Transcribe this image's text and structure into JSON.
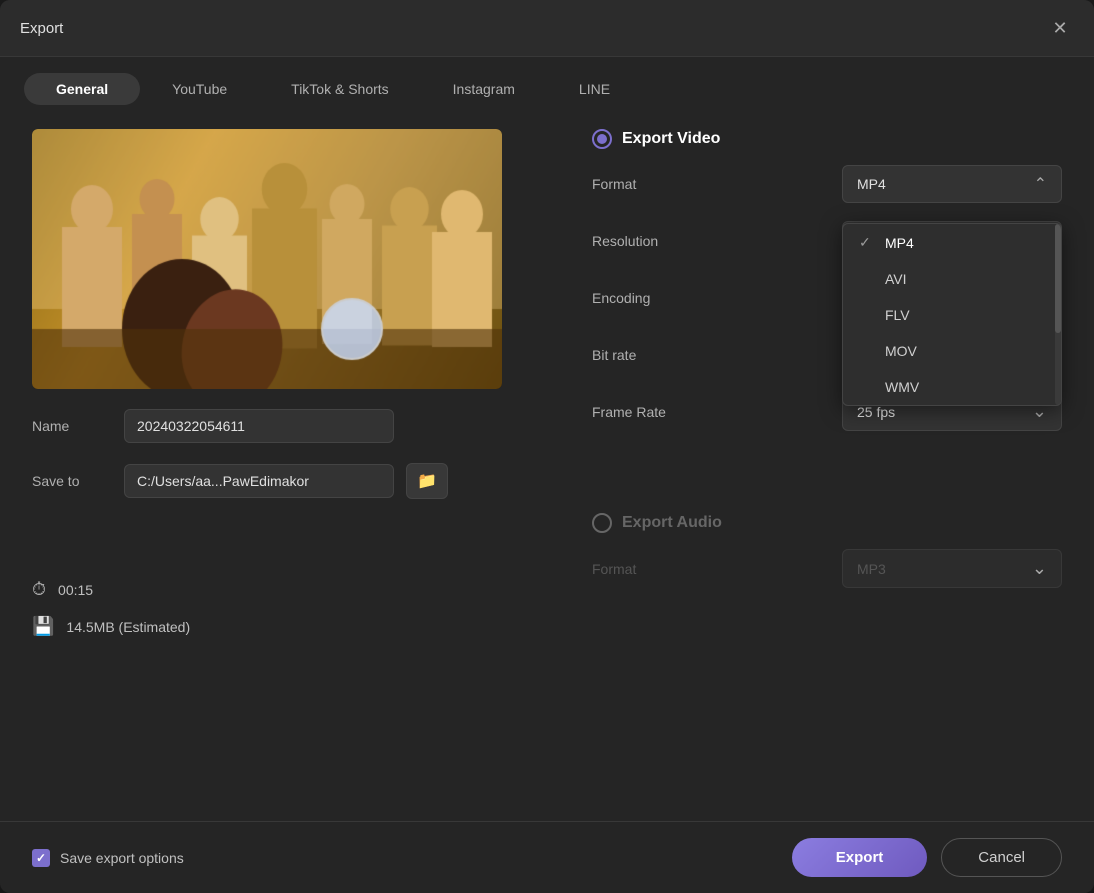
{
  "dialog": {
    "title": "Export",
    "close_label": "✕"
  },
  "tabs": [
    {
      "id": "general",
      "label": "General",
      "active": true
    },
    {
      "id": "youtube",
      "label": "YouTube",
      "active": false
    },
    {
      "id": "tiktok",
      "label": "TikTok & Shorts",
      "active": false
    },
    {
      "id": "instagram",
      "label": "Instagram",
      "active": false
    },
    {
      "id": "line",
      "label": "LINE",
      "active": false
    }
  ],
  "export_video": {
    "section_title": "Export Video",
    "format_label": "Format",
    "format_value": "MP4",
    "resolution_label": "Resolution",
    "encoding_label": "Encoding",
    "bitrate_label": "Bit rate",
    "framerate_label": "Frame Rate",
    "framerate_value": "25  fps",
    "dropdown_options": [
      {
        "label": "MP4",
        "selected": true
      },
      {
        "label": "AVI",
        "selected": false
      },
      {
        "label": "FLV",
        "selected": false
      },
      {
        "label": "MOV",
        "selected": false
      },
      {
        "label": "WMV",
        "selected": false
      }
    ]
  },
  "export_audio": {
    "section_title": "Export Audio",
    "format_label": "Format",
    "format_value": "MP3"
  },
  "meta": {
    "name_label": "Name",
    "name_value": "20240322054611",
    "save_label": "Save to",
    "save_path": "C:/Users/aa...PawEdimakor"
  },
  "stats": {
    "duration_icon": "⏱",
    "duration": "00:15",
    "size_icon": "💾",
    "size": "14.5MB (Estimated)"
  },
  "footer": {
    "save_options_label": "Save export options",
    "export_label": "Export",
    "cancel_label": "Cancel"
  }
}
